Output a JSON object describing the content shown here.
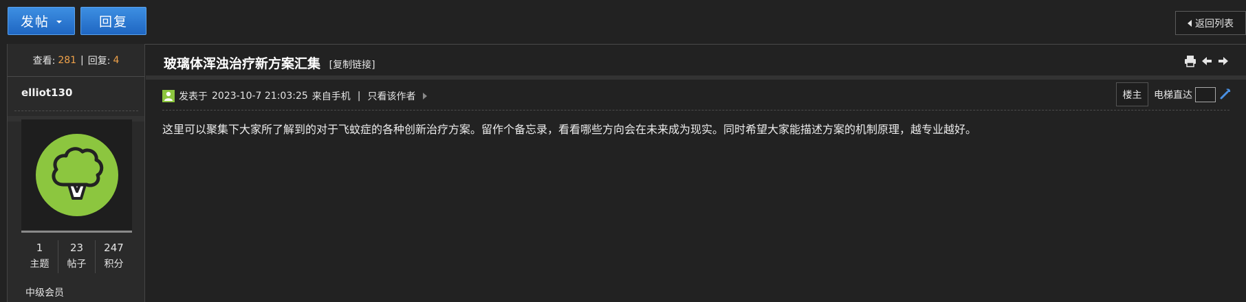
{
  "toolbar": {
    "post_label": "发帖",
    "reply_label": "回复",
    "back_label": "返回列表"
  },
  "thread": {
    "views_label": "查看:",
    "views": "281",
    "replies_label": "回复:",
    "replies": "4",
    "title": "玻璃体浑浊治疗新方案汇集",
    "copy_link": "[复制链接]"
  },
  "author": {
    "name": "elliot130",
    "stats": [
      {
        "value": "1",
        "label": "主题"
      },
      {
        "value": "23",
        "label": "帖子"
      },
      {
        "value": "247",
        "label": "积分"
      }
    ],
    "rank": "中级会员"
  },
  "post": {
    "meta_prefix": "发表于",
    "datetime": "2023-10-7 21:03:25",
    "source": "来自手机",
    "separator": "|",
    "only_author": "只看该作者",
    "floor": "楼主",
    "elevator_label": "电梯直达",
    "body": "这里可以聚集下大家所了解到的对于飞蚊症的各种创新治疗方案。留作个备忘录，看看哪些方向会在未来成为现实。同时希望大家能描述方案的机制原理，越专业越好。"
  },
  "colors": {
    "accent_blue": "#2c7bd6",
    "number_orange": "#f0a24a",
    "avatar_green": "#8cc63f"
  }
}
